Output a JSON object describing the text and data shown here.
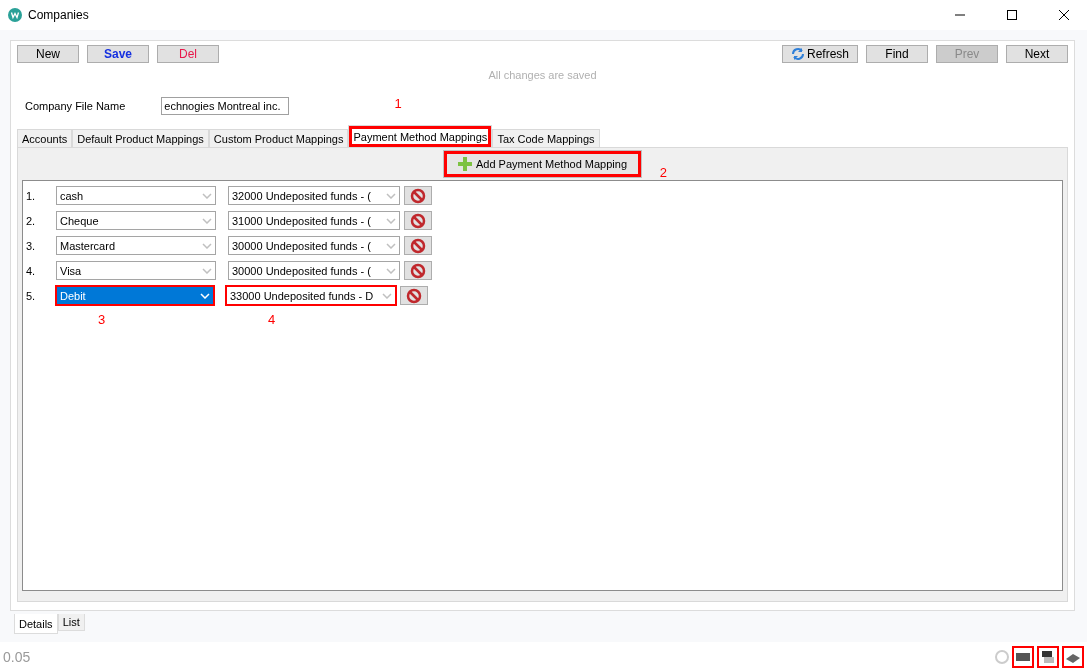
{
  "window": {
    "title": "Companies"
  },
  "toolbar": {
    "new": {
      "label": "New",
      "disabled": false
    },
    "left": [
      {
        "label": "Save",
        "kind": "primary",
        "disabled": false
      },
      {
        "label": "Del",
        "kind": "danger",
        "disabled": false
      }
    ],
    "right": [
      {
        "label": "Refresh",
        "kind": "refresh",
        "disabled": false
      },
      {
        "label": "Find",
        "disabled": false
      },
      {
        "label": "Prev",
        "disabled": true
      },
      {
        "label": "Next",
        "disabled": false
      }
    ]
  },
  "save_status": "All changes are saved",
  "company_file": {
    "label": "Company File Name",
    "value": "echnogies Montreal inc."
  },
  "tabs": [
    {
      "label": "Accounts",
      "selected": false,
      "highlighted": false
    },
    {
      "label": "Default Product Mappings",
      "selected": false,
      "highlighted": false
    },
    {
      "label": "Custom Product Mappings",
      "selected": false,
      "highlighted": false
    },
    {
      "label": "Payment Method Mappings",
      "selected": true,
      "highlighted": true,
      "callout": "1"
    },
    {
      "label": "Tax Code Mappings",
      "selected": false,
      "highlighted": false
    }
  ],
  "add_button": {
    "label": "Add Payment Method Mapping",
    "highlighted": true,
    "callout": "2"
  },
  "mappings": [
    {
      "index": "1.",
      "method": "cash",
      "account": "32000 Undeposited funds - (",
      "focused": false,
      "highlighted": false
    },
    {
      "index": "2.",
      "method": "Cheque",
      "account": "31000 Undeposited funds - (",
      "focused": false,
      "highlighted": false
    },
    {
      "index": "3.",
      "method": "Mastercard",
      "account": "30000 Undeposited funds - (",
      "focused": false,
      "highlighted": false
    },
    {
      "index": "4.",
      "method": "Visa",
      "account": "30000 Undeposited funds - (",
      "focused": false,
      "highlighted": false
    },
    {
      "index": "5.",
      "method": "Debit",
      "account": "33000 Undeposited funds - D",
      "focused": true,
      "highlighted": true,
      "method_callout": "3",
      "account_callout": "4"
    }
  ],
  "bottom_tabs": [
    {
      "label": "Details",
      "selected": true
    },
    {
      "label": "List",
      "selected": false
    }
  ],
  "status_bar": {
    "version": "0.05",
    "tray_highlighted": true
  }
}
